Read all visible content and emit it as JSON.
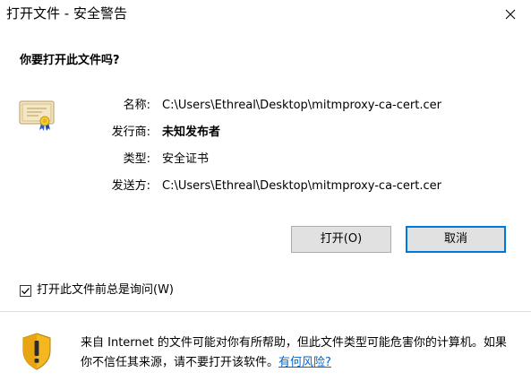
{
  "window": {
    "title": "打开文件 - 安全警告"
  },
  "question": "你要打开此文件吗?",
  "fields": [
    {
      "label": "名称:",
      "value": "C:\\Users\\Ethreal\\Desktop\\mitmproxy-ca-cert.cer",
      "bold": false
    },
    {
      "label": "发行商:",
      "value": "未知发布者",
      "bold": true
    },
    {
      "label": "类型:",
      "value": "安全证书",
      "bold": false
    },
    {
      "label": "发送方:",
      "value": "C:\\Users\\Ethreal\\Desktop\\mitmproxy-ca-cert.cer",
      "bold": false
    }
  ],
  "buttons": {
    "open_label": "打开(O)",
    "cancel_label": "取消"
  },
  "checkbox": {
    "label": "打开此文件前总是询问(W)",
    "checked": true
  },
  "warning": {
    "text": "来自 Internet 的文件可能对你有所帮助，但此文件类型可能危害你的计算机。如果你不信任其来源，请不要打开该软件。",
    "link_label": "有何风险?"
  },
  "icons": {
    "close": "close-icon",
    "certificate": "certificate-icon",
    "shield": "shield-warning-icon",
    "checkmark": "checkmark-icon"
  },
  "colors": {
    "accent": "#0078d7",
    "link": "#0066cc",
    "button_bg": "#e1e1e1"
  }
}
